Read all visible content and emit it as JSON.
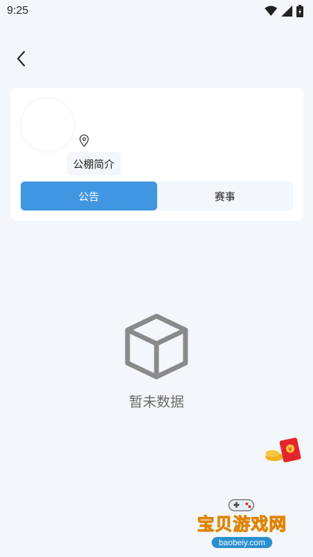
{
  "status_bar": {
    "time": "9:25",
    "icons": [
      "wifi-icon",
      "signal-icon",
      "battery-icon"
    ]
  },
  "nav": {
    "back_icon": "back-arrow-icon"
  },
  "profile": {
    "intro_label": "公棚简介",
    "location_icon": "location-pin-icon"
  },
  "tabs": [
    {
      "label": "公告",
      "active": true
    },
    {
      "label": "赛事",
      "active": false
    }
  ],
  "empty_state": {
    "icon": "box-icon",
    "text": "暂未数据"
  },
  "watermark": {
    "title": "宝贝游戏网",
    "url": "baobeiy.com"
  },
  "colors": {
    "accent": "#4196e2",
    "background": "#f3f6fa",
    "empty_icon": "#8a8a8a"
  }
}
